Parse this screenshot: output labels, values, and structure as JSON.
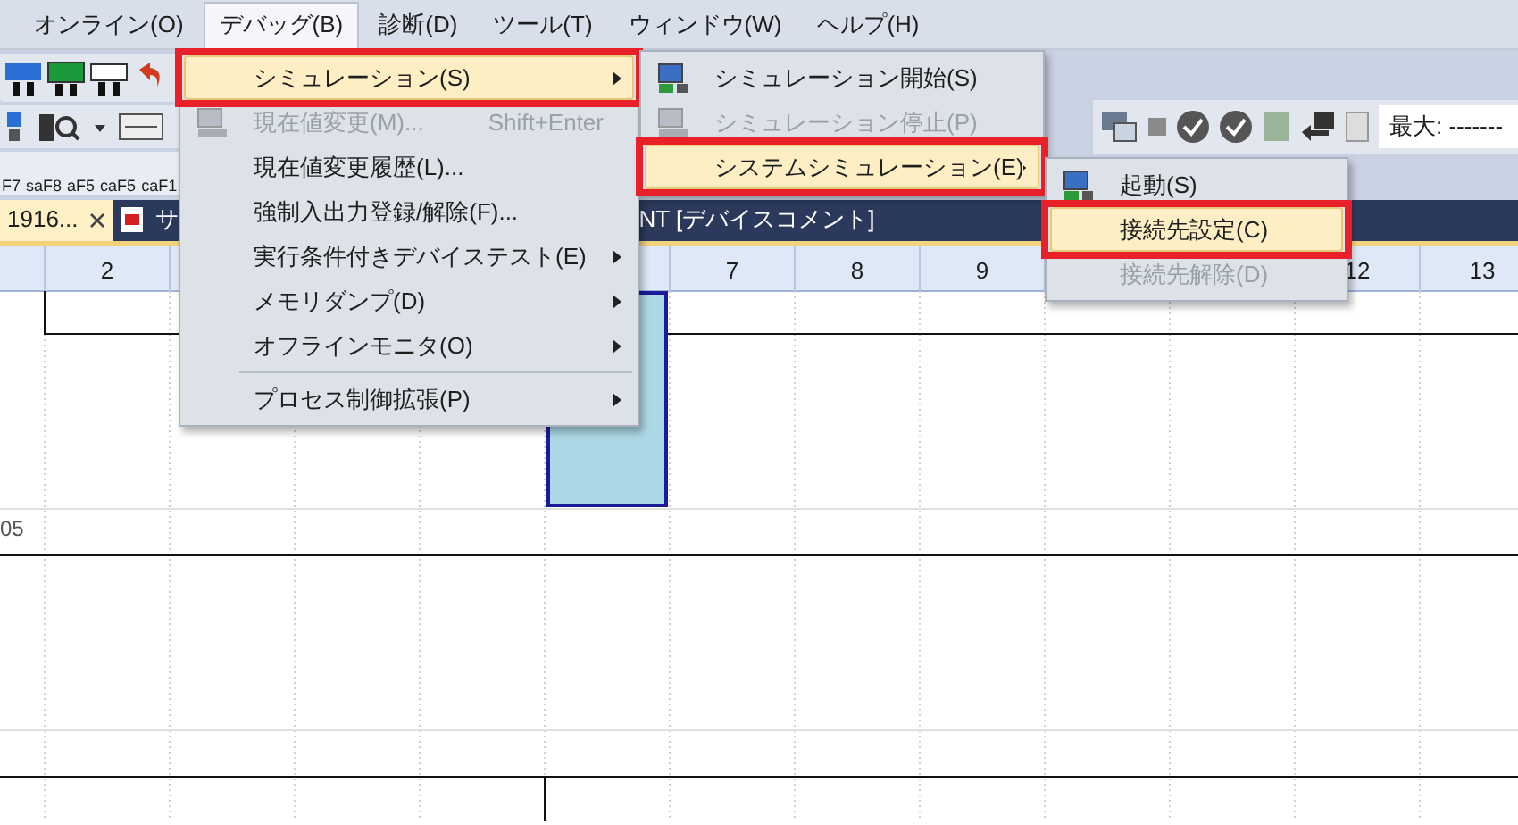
{
  "menu_bar": [
    {
      "label": "オンライン(O)",
      "selected": false
    },
    {
      "label": "デバッグ(B)",
      "selected": true
    },
    {
      "label": "診断(D)",
      "selected": false
    },
    {
      "label": "ツール(T)",
      "selected": false
    },
    {
      "label": "ウィンドウ(W)",
      "selected": false
    },
    {
      "label": "ヘルプ(H)",
      "selected": false
    }
  ],
  "toolbar": {
    "field_value": "最大: -------",
    "function_keys": [
      "F7",
      "saF8",
      "aF5",
      "caF5",
      "caF1"
    ]
  },
  "tabs": [
    {
      "label": "1916...",
      "selected": true,
      "closable": true
    },
    {
      "label": "サ",
      "selected": false,
      "closable": false
    },
    {
      "label": "NT [デバイスコメント]",
      "selected": false,
      "closable": false
    }
  ],
  "grid": {
    "column_headers": [
      "2",
      "7",
      "8",
      "9",
      "12",
      "13"
    ],
    "row_label": "05"
  },
  "menus": [
    {
      "items": [
        {
          "label": "シミュレーション(S)",
          "submenu": true,
          "selected": true,
          "disabled": false,
          "callout": true
        },
        {
          "label": "現在値変更(M)...",
          "shortcut": "Shift+Enter",
          "submenu": false,
          "selected": false,
          "disabled": true,
          "callout": false,
          "icon": true
        },
        {
          "label": "現在値変更履歴(L)...",
          "submenu": false,
          "selected": false,
          "disabled": false,
          "callout": false
        },
        {
          "label": "強制入出力登録/解除(F)...",
          "submenu": false,
          "selected": false,
          "disabled": false,
          "callout": false
        },
        {
          "label": "実行条件付きデバイステスト(E)",
          "submenu": true,
          "selected": false,
          "disabled": false,
          "callout": false
        },
        {
          "label": "メモリダンプ(D)",
          "submenu": true,
          "selected": false,
          "disabled": false,
          "callout": false
        },
        {
          "label": "オフラインモニタ(O)",
          "submenu": true,
          "selected": false,
          "disabled": false,
          "callout": false,
          "separator_after": true
        },
        {
          "label": "プロセス制御拡張(P)",
          "submenu": true,
          "selected": false,
          "disabled": false,
          "callout": false
        }
      ]
    },
    {
      "items": [
        {
          "label": "シミュレーション開始(S)",
          "submenu": false,
          "selected": false,
          "disabled": false,
          "callout": false,
          "icon": true
        },
        {
          "label": "シミュレーション停止(P)",
          "submenu": false,
          "selected": false,
          "disabled": true,
          "callout": false,
          "icon": true
        },
        {
          "label": "システムシミュレーション(E)",
          "submenu": true,
          "selected": true,
          "disabled": false,
          "callout": true
        }
      ]
    },
    {
      "items": [
        {
          "label": "起動(S)",
          "submenu": false,
          "selected": false,
          "disabled": false,
          "callout": false,
          "icon": true
        },
        {
          "label": "接続先設定(C)",
          "submenu": false,
          "selected": true,
          "disabled": false,
          "callout": true
        },
        {
          "label": "接続先解除(D)",
          "submenu": false,
          "selected": false,
          "disabled": true,
          "callout": false
        }
      ]
    }
  ]
}
